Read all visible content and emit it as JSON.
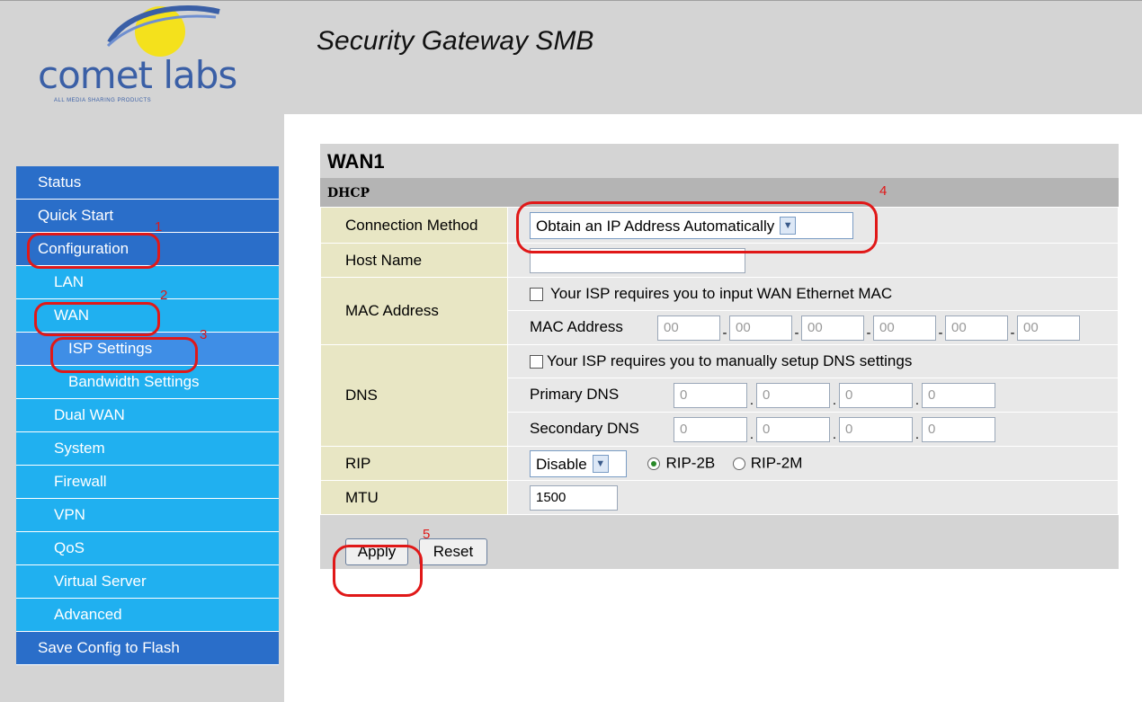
{
  "header": {
    "logo_text": "comet labs",
    "logo_tagline": "ALL MEDIA SHARING PRODUCTS",
    "app_title": "Security Gateway SMB"
  },
  "sidebar": {
    "items": [
      {
        "label": "Status"
      },
      {
        "label": "Quick Start"
      },
      {
        "label": "Configuration"
      },
      {
        "label": "LAN"
      },
      {
        "label": "WAN"
      },
      {
        "label": "ISP Settings"
      },
      {
        "label": "Bandwidth Settings"
      },
      {
        "label": "Dual WAN"
      },
      {
        "label": "System"
      },
      {
        "label": "Firewall"
      },
      {
        "label": "VPN"
      },
      {
        "label": "QoS"
      },
      {
        "label": "Virtual Server"
      },
      {
        "label": "Advanced"
      },
      {
        "label": "Save Config to Flash"
      }
    ]
  },
  "panel": {
    "title": "WAN1",
    "section": "DHCP",
    "connection_method": {
      "label": "Connection Method",
      "value": "Obtain an IP Address Automatically"
    },
    "host_name": {
      "label": "Host Name",
      "value": ""
    },
    "mac": {
      "label": "MAC Address",
      "checkbox_text": "Your ISP requires you to input WAN Ethernet MAC",
      "field_label": "MAC Address",
      "octets": [
        "00",
        "00",
        "00",
        "00",
        "00",
        "00"
      ],
      "separator": "-"
    },
    "dns": {
      "label": "DNS",
      "checkbox_text": "Your ISP requires you to manually setup DNS settings",
      "primary_label": "Primary DNS",
      "secondary_label": "Secondary DNS",
      "primary": [
        "0",
        "0",
        "0",
        "0"
      ],
      "secondary": [
        "0",
        "0",
        "0",
        "0"
      ],
      "separator": "."
    },
    "rip": {
      "label": "RIP",
      "value": "Disable",
      "option1": "RIP-2B",
      "option2": "RIP-2M"
    },
    "mtu": {
      "label": "MTU",
      "value": "1500"
    },
    "apply_label": "Apply",
    "reset_label": "Reset"
  },
  "annotations": {
    "n1": "1",
    "n2": "2",
    "n3": "3",
    "n4": "4",
    "n5": "5",
    "color": "#e01818"
  }
}
